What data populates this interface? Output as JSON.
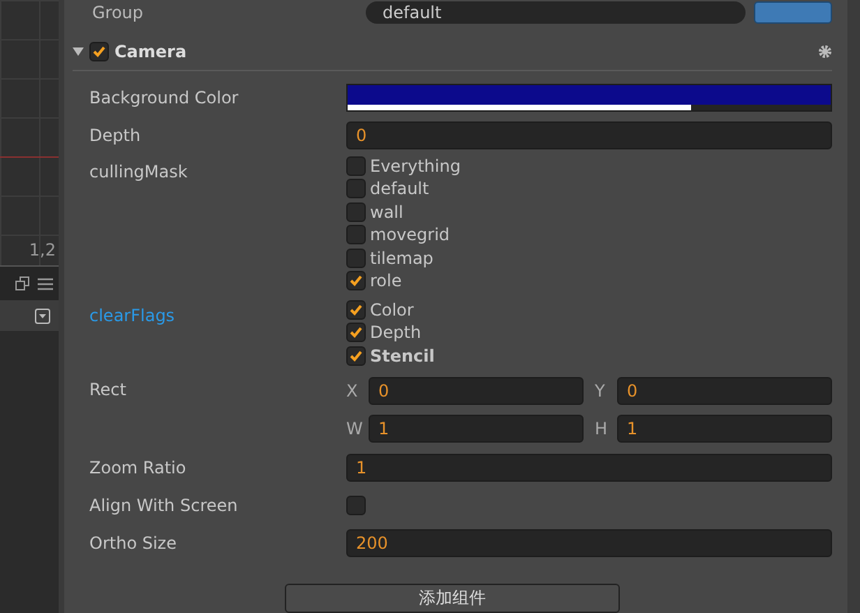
{
  "left_panel": {
    "ruler_label": "1,2"
  },
  "group_row": {
    "label": "Group",
    "value": "default"
  },
  "component": {
    "title": "Camera",
    "enabled": true,
    "expanded": true
  },
  "properties": [
    {
      "kind": "color",
      "label": "Background Color",
      "color": "#0c0a8c",
      "level": 0.71
    },
    {
      "kind": "number",
      "label": "Depth",
      "value": "0"
    },
    {
      "kind": "checklist",
      "label": "cullingMask",
      "highlighted": false,
      "options": [
        {
          "label": "Everything",
          "checked": false,
          "bold": false
        },
        {
          "label": "default",
          "checked": false,
          "bold": false
        },
        {
          "label": "wall",
          "checked": false,
          "bold": false
        },
        {
          "label": "movegrid",
          "checked": false,
          "bold": false
        },
        {
          "label": "tilemap",
          "checked": false,
          "bold": false
        },
        {
          "label": "role",
          "checked": true,
          "bold": false
        }
      ]
    },
    {
      "kind": "checklist",
      "label": "clearFlags",
      "highlighted": true,
      "options": [
        {
          "label": "Color",
          "checked": true,
          "bold": false
        },
        {
          "label": "Depth",
          "checked": true,
          "bold": false
        },
        {
          "label": "Stencil",
          "checked": true,
          "bold": true
        }
      ]
    },
    {
      "kind": "rect",
      "label": "Rect",
      "fields": [
        {
          "axis": "X",
          "value": "0"
        },
        {
          "axis": "Y",
          "value": "0"
        },
        {
          "axis": "W",
          "value": "1"
        },
        {
          "axis": "H",
          "value": "1"
        }
      ]
    },
    {
      "kind": "number",
      "label": "Zoom Ratio",
      "value": "1"
    },
    {
      "kind": "toggle",
      "label": "Align With Screen",
      "checked": false
    },
    {
      "kind": "number",
      "label": "Ortho Size",
      "value": "200"
    }
  ],
  "add_button": "添加组件"
}
